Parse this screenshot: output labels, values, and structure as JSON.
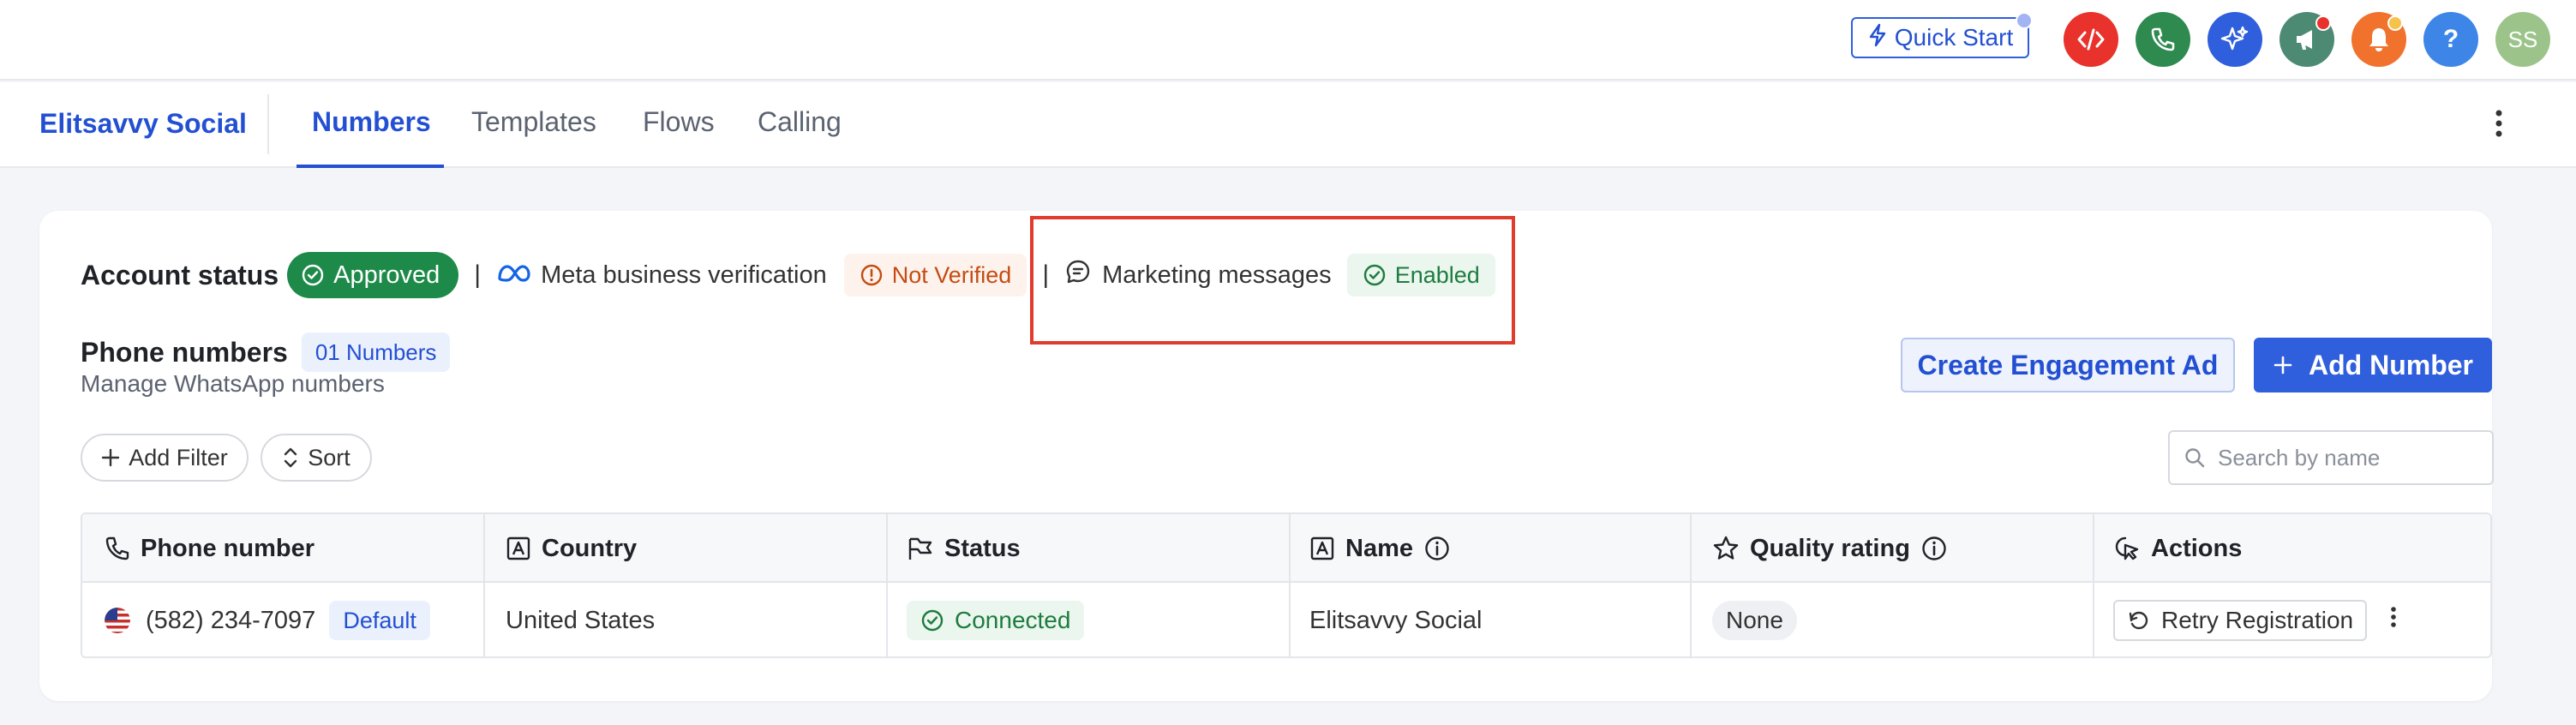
{
  "topbar": {
    "quick_start_label": "Quick Start",
    "avatar_initials": "SS",
    "help_symbol": "?",
    "icons": [
      "code-icon",
      "phone-icon",
      "sparkle-icon",
      "megaphone-icon",
      "bell-icon",
      "help-icon"
    ],
    "colors": {
      "code": "#e8322b",
      "phone": "#2e8a4f",
      "sparkle": "#2f5fdc",
      "megaphone": "#4d8a74",
      "bell": "#f0722c",
      "help": "#3d86e8",
      "avatar": "#9cc48a"
    }
  },
  "nav": {
    "brand": "Elitsavvy Social",
    "tabs": [
      {
        "label": "Numbers",
        "active": true
      },
      {
        "label": "Templates",
        "active": false
      },
      {
        "label": "Flows",
        "active": false
      },
      {
        "label": "Calling",
        "active": false
      }
    ]
  },
  "account": {
    "status_label": "Account status",
    "status_value": "Approved",
    "separator": "|",
    "meta_label": "Meta business verification",
    "meta_status": "Not Verified",
    "marketing_label": "Marketing messages",
    "marketing_status": "Enabled"
  },
  "phone_numbers": {
    "title": "Phone numbers",
    "count_badge": "01 Numbers",
    "subtitle": "Manage WhatsApp numbers",
    "create_ad_label": "Create Engagement Ad",
    "add_number_label": "Add Number",
    "add_filter_label": "Add Filter",
    "sort_label": "Sort",
    "search_placeholder": "Search by name"
  },
  "table": {
    "headers": [
      "Phone number",
      "Country",
      "Status",
      "Name",
      "Quality rating",
      "Actions"
    ],
    "rows": [
      {
        "phone": "(582) 234-7097",
        "default_badge": "Default",
        "country": "United States",
        "status": "Connected",
        "name": "Elitsavvy Social",
        "quality": "None",
        "action": "Retry Registration"
      }
    ]
  }
}
